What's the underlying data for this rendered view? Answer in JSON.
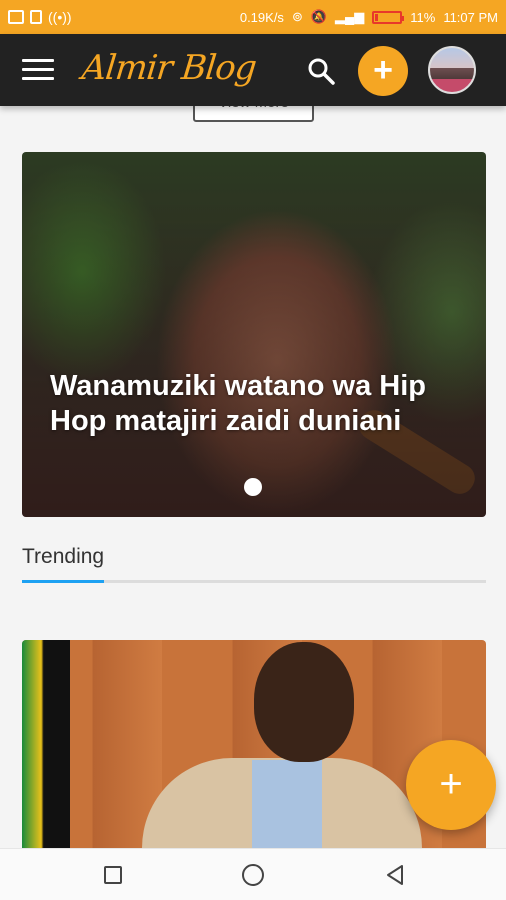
{
  "status_bar": {
    "network_speed": "0.19K/s",
    "battery_percent": "11%",
    "battery_level": 0.11,
    "time": "11:07 PM",
    "icons": [
      "screenshot-icon",
      "sim-icon",
      "hotspot-icon",
      "sync-icon",
      "mute-icon",
      "signal-icon",
      "battery-icon"
    ]
  },
  "app_bar": {
    "brand": "Almir Blog",
    "menu_icon": "hamburger-menu-icon",
    "search_icon": "search-icon",
    "add_label": "+",
    "avatar_icon": "user-avatar"
  },
  "feed": {
    "view_more_label": "View More",
    "hero": {
      "title": "Wanamuziki watano wa Hip Hop matajiri zaidi duniani",
      "pager_dots": 1,
      "active_dot": 1
    },
    "trending_label": "Trending",
    "trending_card": {
      "image": "man-in-suit-photo"
    }
  },
  "fab": {
    "label": "+"
  },
  "nav_bar": {
    "items": [
      "recent-apps-icon",
      "home-icon",
      "back-icon"
    ]
  },
  "colors": {
    "accent": "#f5a623",
    "app_bar": "#222222",
    "trending_accent": "#1da1f2"
  }
}
